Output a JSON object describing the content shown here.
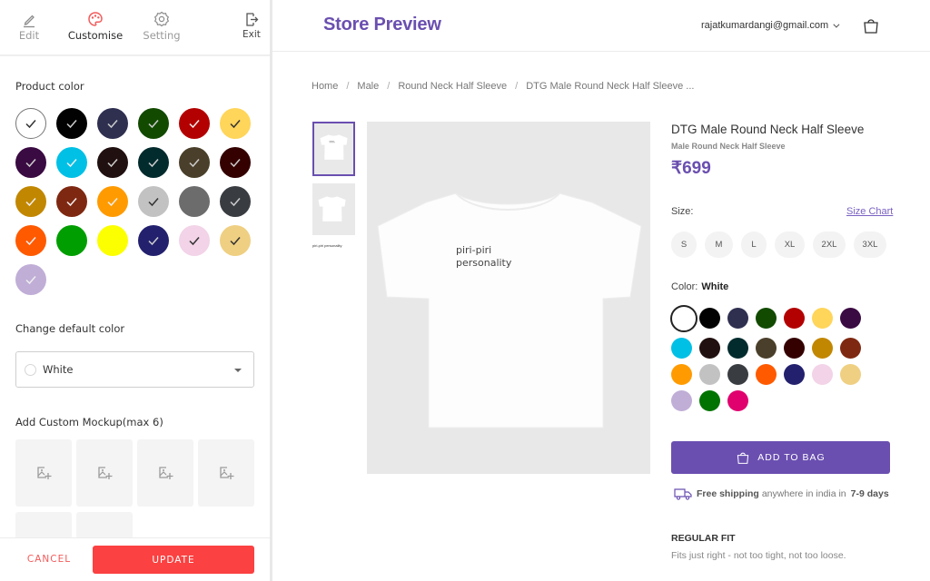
{
  "sidebar": {
    "nav": {
      "edit": "Edit",
      "customise": "Customise",
      "setting": "Setting",
      "exit": "Exit",
      "active": "customise",
      "accent_color": "#f25b5b"
    },
    "product_color_label": "Product color",
    "product_colors": [
      {
        "hex": "#ffffff",
        "checked": true,
        "check_color": "#333333",
        "bordered": true
      },
      {
        "hex": "#020202",
        "checked": true,
        "check_color": "#cccccc"
      },
      {
        "hex": "#2f3050",
        "checked": true,
        "check_color": "#cccccc"
      },
      {
        "hex": "#124a00",
        "checked": true,
        "check_color": "#cccccc"
      },
      {
        "hex": "#b30000",
        "checked": true,
        "check_color": "#eeeeee"
      },
      {
        "hex": "#ffd55a",
        "checked": true,
        "check_color": "#333333"
      },
      {
        "hex": "#3a0a42",
        "checked": true,
        "check_color": "#cccccc"
      },
      {
        "hex": "#00c0e6",
        "checked": true,
        "check_color": "#eeeeee"
      },
      {
        "hex": "#211010",
        "checked": true,
        "check_color": "#cccccc"
      },
      {
        "hex": "#022b2e",
        "checked": true,
        "check_color": "#cccccc"
      },
      {
        "hex": "#4a3f2a",
        "checked": true,
        "check_color": "#cccccc"
      },
      {
        "hex": "#340000",
        "checked": true,
        "check_color": "#cccccc"
      },
      {
        "hex": "#c28700",
        "checked": true,
        "check_color": "#eeeeee"
      },
      {
        "hex": "#7f2811",
        "checked": true,
        "check_color": "#eeeeee"
      },
      {
        "hex": "#ff9b00",
        "checked": true,
        "check_color": "#eeeeee"
      },
      {
        "hex": "#c2c2c2",
        "checked": true,
        "check_color": "#333333"
      },
      {
        "hex": "#6c6c6c",
        "checked": false
      },
      {
        "hex": "#393d42",
        "checked": true,
        "check_color": "#cccccc"
      },
      {
        "hex": "#ff5a00",
        "checked": true,
        "check_color": "#eeeeee"
      },
      {
        "hex": "#009e00",
        "checked": false
      },
      {
        "hex": "#fbff00",
        "checked": false
      },
      {
        "hex": "#23216e",
        "checked": true,
        "check_color": "#cccccc"
      },
      {
        "hex": "#f2d3e7",
        "checked": true,
        "check_color": "#333333"
      },
      {
        "hex": "#efcf82",
        "checked": true,
        "check_color": "#333333"
      },
      {
        "hex": "#c0aed7",
        "checked": true,
        "check_color": "#eeeeee"
      }
    ],
    "default_color_label": "Change default color",
    "default_color_value": "White",
    "mockup_label": "Add Custom Mockup(max 6)",
    "mockup_slots": 6,
    "cancel_label": "CANCEL",
    "update_label": "UPDATE"
  },
  "preview": {
    "brand": "Store Preview",
    "account_email": "rajatkumardangi@gmail.com",
    "breadcrumb": [
      "Home",
      "Male",
      "Round Neck Half Sleeve",
      "DTG Male Round Neck Half Sleeve ..."
    ],
    "thumb_caption": "piri-piri personality",
    "shirt_print": [
      "piri-piri",
      "personality"
    ],
    "product": {
      "title": "DTG Male Round Neck Half Sleeve",
      "subtitle": "Male Round Neck Half Sleeve",
      "price": "₹699",
      "size_label": "Size:",
      "size_chart": "Size Chart",
      "sizes": [
        "S",
        "M",
        "L",
        "XL",
        "2XL",
        "3XL"
      ],
      "color_label": "Color:",
      "color_value": "White",
      "colors": [
        "#ffffff",
        "#020202",
        "#2f3050",
        "#124a00",
        "#b30000",
        "#ffd55a",
        "#3a0a42",
        "#00c0e6",
        "#211010",
        "#022b2e",
        "#4a3f2a",
        "#340000",
        "#c28700",
        "#7f2811",
        "#ff9b00",
        "#c2c2c2",
        "#393d42",
        "#ff5a00",
        "#23216e",
        "#f2d3e7",
        "#efcf82",
        "#c0aed7",
        "#007300",
        "#e0006e"
      ],
      "selected_color_index": 0,
      "add_to_bag": "ADD TO BAG",
      "shipping": {
        "bold": "Free shipping",
        "text": "anywhere in india in",
        "days": "7-9 days"
      },
      "fit_title": "REGULAR FIT",
      "fit_desc": "Fits just right - not too tight, not too loose."
    },
    "accent_color": "#6a4fb0"
  }
}
